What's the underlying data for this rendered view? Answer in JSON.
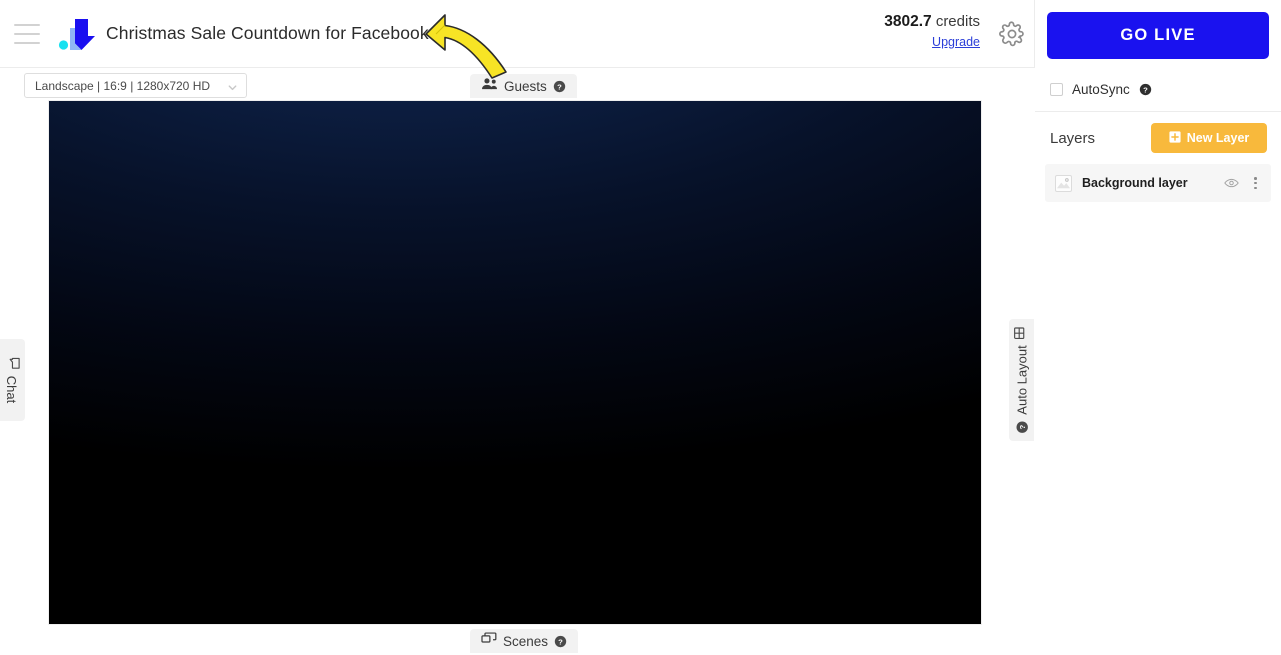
{
  "header": {
    "menu_icon": "hamburger-icon",
    "logo_icon": "brand-logo-icon",
    "doc_title": "Christmas Sale Countdown for Facebook",
    "edit_icon": "pencil-icon",
    "credits_amount": "3802.7",
    "credits_word": "credits",
    "upgrade_label": "Upgrade",
    "settings_icon": "gear-icon",
    "go_live_label": "GO LIVE"
  },
  "stage": {
    "preset_label": "Landscape | 16:9 | 1280x720 HD",
    "preset_chevron_icon": "chevron-down-icon",
    "guests_label": "Guests",
    "guests_icon": "people-icon",
    "guests_help_icon": "help-circle-icon",
    "scenes_label": "Scenes",
    "scenes_icon": "scenes-icon",
    "scenes_help_icon": "help-circle-icon",
    "chat_label": "Chat",
    "chat_icon": "chat-bubble-icon",
    "auto_layout_label": "Auto Layout",
    "auto_layout_icon": "layout-grid-icon",
    "auto_layout_help_icon": "help-circle-icon",
    "canvas_top_color": "#17305e",
    "canvas_bottom_color": "#000000"
  },
  "right_panel": {
    "autosync_label": "AutoSync",
    "autosync_help_icon": "help-circle-icon",
    "autosync_checked": false,
    "layers_title": "Layers",
    "new_layer_label": "New Layer",
    "new_layer_icon": "plus-square-icon",
    "new_layer_color": "#f8b93c",
    "layers": [
      {
        "name": "Background layer",
        "thumbnail_icon": "image-thumb-icon",
        "visibility_icon": "eye-icon",
        "menu_icon": "kebab-menu-icon"
      }
    ]
  },
  "annotation": {
    "arrow_icon": "curved-arrow-annotation",
    "arrow_color": "#f7e425"
  }
}
